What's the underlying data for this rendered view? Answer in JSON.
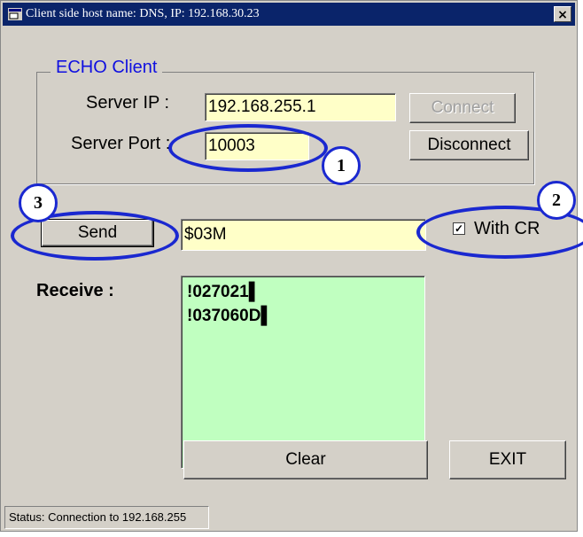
{
  "window": {
    "title": "Client side host name: DNS,   IP: 192.168.30.23",
    "close_label": "×"
  },
  "group": {
    "title": "ECHO  Client"
  },
  "server_ip": {
    "label": "Server IP :",
    "value": "192.168.255.1"
  },
  "server_port": {
    "label": "Server Port :",
    "value": "10003"
  },
  "buttons": {
    "connect": "Connect",
    "disconnect": "Disconnect",
    "send": "Send",
    "clear": "Clear",
    "exit": "EXIT"
  },
  "command": {
    "value": "$03M"
  },
  "with_cr": {
    "label": "With CR",
    "checked": true,
    "check_glyph": "✓"
  },
  "receive": {
    "label": "Receive :",
    "lines": [
      "!027021▌",
      "!037060D▌"
    ]
  },
  "status": {
    "text": "Status: Connection to 192.168.255"
  },
  "annotations": {
    "badge1": "1",
    "badge2": "2",
    "badge3": "3"
  },
  "colors": {
    "annotation": "#1a28d0",
    "input_bg": "#ffffc8",
    "receive_bg": "#c0ffc0",
    "group_title": "#1010e0"
  }
}
